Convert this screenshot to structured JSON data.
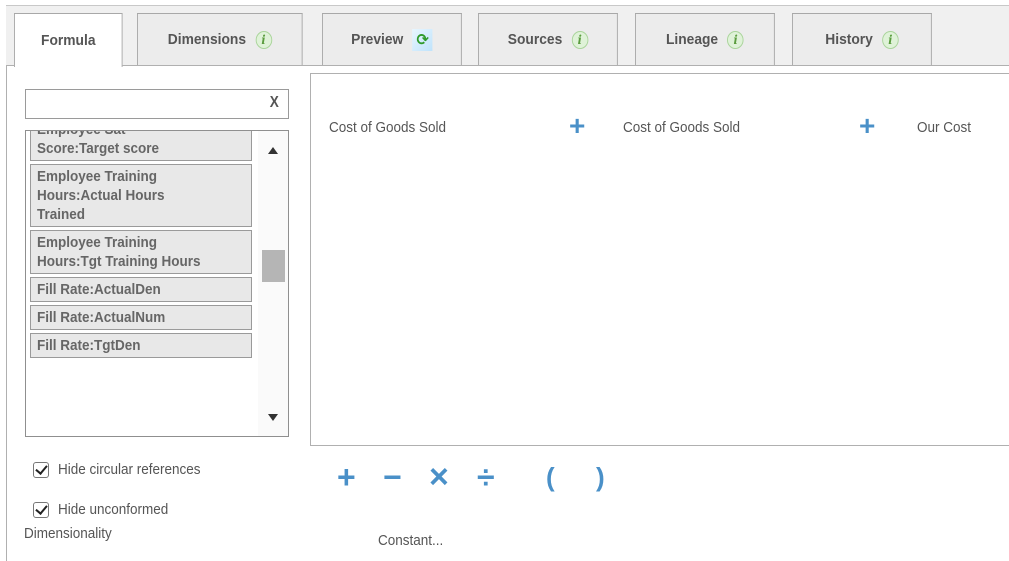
{
  "tabs": [
    {
      "label": "Formula",
      "icon": null,
      "active": true
    },
    {
      "label": "Dimensions",
      "icon": "info-icon",
      "active": false
    },
    {
      "label": "Preview",
      "icon": "refresh-icon",
      "active": false
    },
    {
      "label": "Sources",
      "icon": "info-icon",
      "active": false
    },
    {
      "label": "Lineage",
      "icon": "info-icon",
      "active": false
    },
    {
      "label": "History",
      "icon": "info-icon",
      "active": false
    }
  ],
  "search": {
    "value": "",
    "placeholder": "",
    "clear_label": "X"
  },
  "list": {
    "items": [
      "Employee Sat\nScore:Target score",
      "Employee Training\nHours:Actual Hours\nTrained",
      "Employee Training\nHours:Tgt Training Hours",
      "Fill Rate:ActualDen",
      "Fill Rate:ActualNum",
      "Fill Rate:TgtDen"
    ]
  },
  "options": {
    "hide_circular": {
      "label": "Hide circular references",
      "checked": true
    },
    "hide_unconformed": {
      "label": "Hide unconformed",
      "label_cont": "Dimensionality",
      "checked": true
    }
  },
  "formula": {
    "tokens": [
      "Cost of Goods Sold",
      "+",
      "Cost of Goods Sold",
      "+",
      "Our Cost"
    ]
  },
  "operators": [
    "+",
    "−",
    "×",
    "÷",
    "(",
    ")"
  ],
  "constant_label": "Constant...",
  "colors": {
    "accent": "#4a90c8",
    "info_green": "#5a9c3e"
  }
}
